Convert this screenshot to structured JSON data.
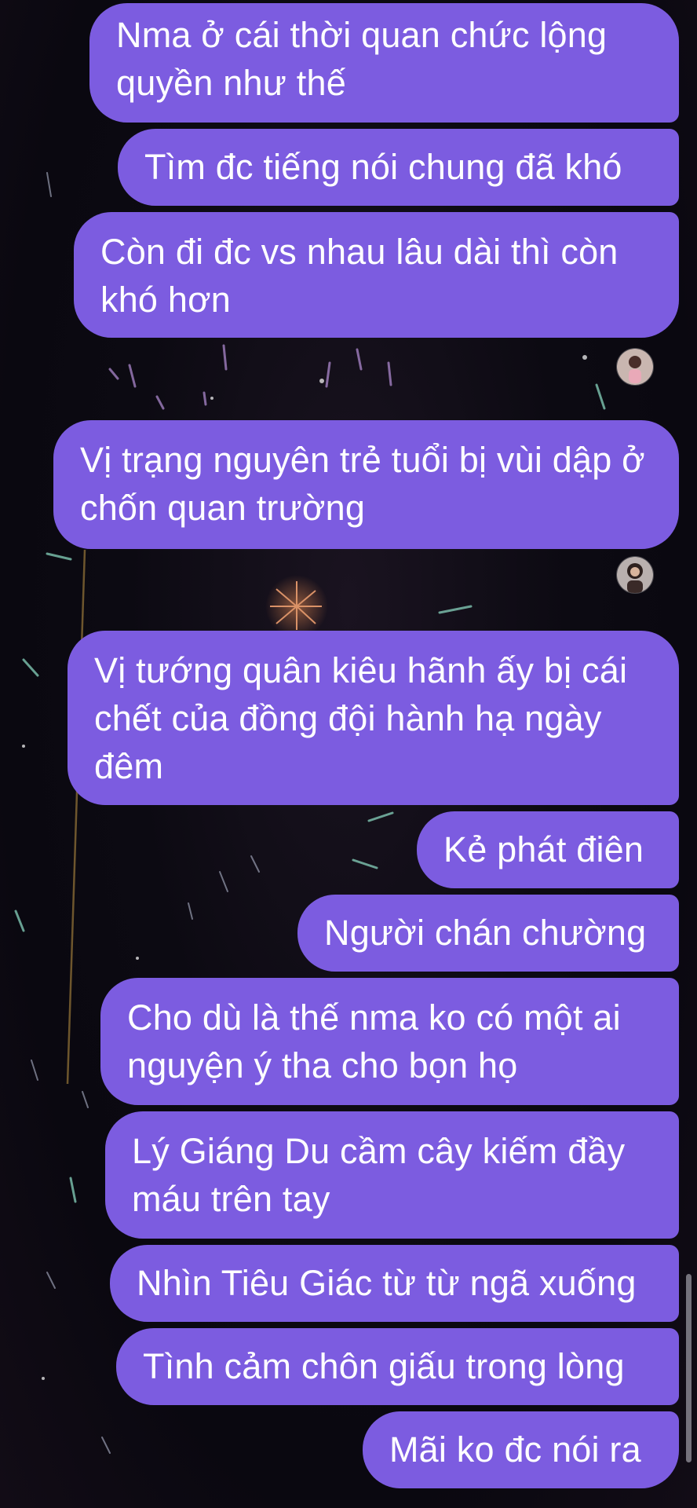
{
  "messages": [
    {
      "text": "Nma ở cái thời quan chức lộng quyền như thế"
    },
    {
      "text": "Tìm đc tiếng nói chung đã khó"
    },
    {
      "text": "Còn đi đc vs nhau lâu dài thì còn khó hơn"
    },
    {
      "text": "Vị trạng nguyên trẻ tuổi bị vùi dập ở chốn quan trường"
    },
    {
      "text": "Vị tướng quân kiêu hãnh ấy bị cái chết của đồng đội hành hạ ngày đêm"
    },
    {
      "text": "Kẻ phát điên"
    },
    {
      "text": "Người chán chường"
    },
    {
      "text": "Cho dù là thế nma ko có một ai nguyện ý tha cho bọn họ"
    },
    {
      "text": "Lý Giáng Du cầm cây kiếm đầy máu trên tay"
    },
    {
      "text": "Nhìn Tiêu Giác từ từ ngã xuống"
    },
    {
      "text": "Tình cảm chôn giấu trong lòng"
    },
    {
      "text": "Mãi ko đc nói ra"
    }
  ],
  "colors": {
    "bubble": "#7c5ce0",
    "background": "#0c0a12"
  },
  "icons": {
    "read_receipt_1": "avatar-icon",
    "read_receipt_2": "avatar-icon"
  }
}
